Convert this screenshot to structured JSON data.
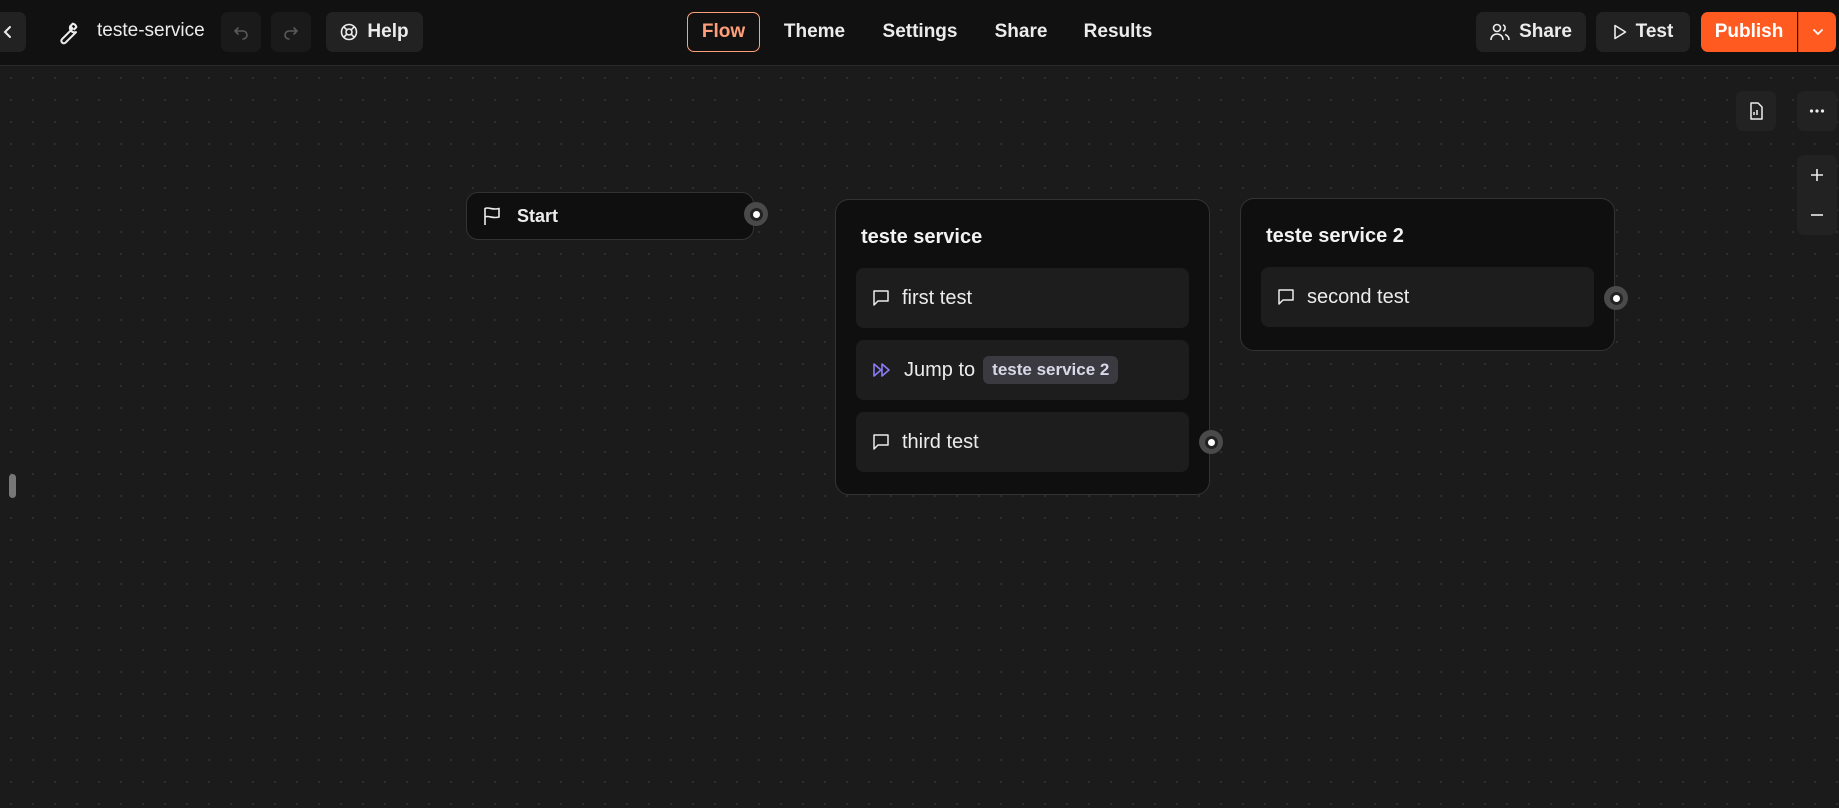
{
  "header": {
    "title": "teste-service",
    "help_label": "Help",
    "tabs": [
      {
        "label": "Flow",
        "active": true
      },
      {
        "label": "Theme",
        "active": false
      },
      {
        "label": "Settings",
        "active": false
      },
      {
        "label": "Share",
        "active": false
      },
      {
        "label": "Results",
        "active": false
      }
    ],
    "share_label": "Share",
    "test_label": "Test",
    "publish_label": "Publish"
  },
  "icons": {
    "back": "chevron-left-icon",
    "settings": "wrench-icon",
    "undo": "undo-icon",
    "redo": "redo-icon",
    "help": "lifebuoy-icon",
    "share": "users-icon",
    "test": "play-icon",
    "publish_menu": "chevron-down-icon",
    "start": "flag-icon",
    "text_bubble": "chat-bubble-icon",
    "jump": "fast-forward-icon",
    "preview": "document-icon",
    "more": "more-horizontal-icon",
    "zoom_in": "plus-icon",
    "zoom_out": "minus-icon"
  },
  "colors": {
    "accent": "#ff5a1f",
    "active_tab": "#ff9f7a",
    "jump_icon": "#8b7cf6"
  },
  "canvas": {
    "start_node": {
      "label": "Start"
    },
    "groups": [
      {
        "title": "teste service",
        "blocks": [
          {
            "type": "text",
            "label": "first test"
          },
          {
            "type": "jump",
            "label": "Jump to",
            "target": "teste service 2"
          },
          {
            "type": "text",
            "label": "third test"
          }
        ]
      },
      {
        "title": "teste service 2",
        "blocks": [
          {
            "type": "text",
            "label": "second test"
          }
        ]
      }
    ]
  }
}
